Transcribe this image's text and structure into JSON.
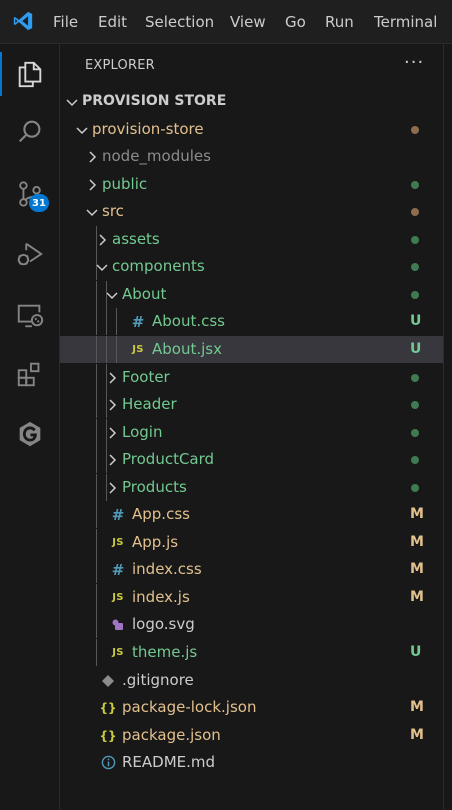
{
  "menu": [
    "File",
    "Edit",
    "Selection",
    "View",
    "Go",
    "Run",
    "Terminal"
  ],
  "activity_bar": {
    "items": [
      {
        "name": "explorer-icon"
      },
      {
        "name": "search-icon"
      },
      {
        "name": "source-control-icon",
        "badge": "31"
      },
      {
        "name": "run-debug-icon"
      },
      {
        "name": "remote-explorer-icon"
      },
      {
        "name": "extensions-icon"
      },
      {
        "name": "gitlens-icon"
      }
    ]
  },
  "explorer": {
    "title": "EXPLORER",
    "more": "···",
    "colors": {
      "untracked": "#73c991",
      "modified": "#e2c08d",
      "ignored": "#8c8c8c",
      "folder_modified": "#8c6e4e",
      "folder_untracked": "#3f7a52",
      "css_icon": "#519aba",
      "js_icon": "#cbcb41",
      "json_icon": "#cbcb41",
      "svg_icon": "#a074c4",
      "info_icon": "#519aba"
    },
    "tree": [
      {
        "label": "PROVISION STORE",
        "depth": 0,
        "kind": "root",
        "chevron": "down",
        "color": "#cccccc"
      },
      {
        "label": "provision-store",
        "depth": 1,
        "kind": "folder",
        "chevron": "down",
        "color": "#e2c08d",
        "dot": "#8c6e4e"
      },
      {
        "label": "node_modules",
        "depth": 2,
        "kind": "folder",
        "chevron": "right",
        "color": "#8c8c8c"
      },
      {
        "label": "public",
        "depth": 2,
        "kind": "folder",
        "chevron": "right",
        "color": "#73c991",
        "dot": "#3f7a52"
      },
      {
        "label": "src",
        "depth": 2,
        "kind": "folder",
        "chevron": "down",
        "color": "#e2c08d",
        "dot": "#8c6e4e"
      },
      {
        "label": "assets",
        "depth": 3,
        "kind": "folder",
        "chevron": "right",
        "color": "#73c991",
        "dot": "#3f7a52"
      },
      {
        "label": "components",
        "depth": 3,
        "kind": "folder",
        "chevron": "down",
        "color": "#73c991",
        "dot": "#3f7a52"
      },
      {
        "label": "About",
        "depth": 4,
        "kind": "folder",
        "chevron": "down",
        "color": "#73c991",
        "dot": "#3f7a52"
      },
      {
        "label": "About.css",
        "depth": 5,
        "kind": "file",
        "icon": "#",
        "icon_color": "#519aba",
        "color": "#73c991",
        "status": "U"
      },
      {
        "label": "About.jsx",
        "depth": 5,
        "kind": "file",
        "icon": "JS",
        "icon_color": "#cbcb41",
        "color": "#73c991",
        "status": "U",
        "selected": true
      },
      {
        "label": "Footer",
        "depth": 4,
        "kind": "folder",
        "chevron": "right",
        "color": "#73c991",
        "dot": "#3f7a52"
      },
      {
        "label": "Header",
        "depth": 4,
        "kind": "folder",
        "chevron": "right",
        "color": "#73c991",
        "dot": "#3f7a52"
      },
      {
        "label": "Login",
        "depth": 4,
        "kind": "folder",
        "chevron": "right",
        "color": "#73c991",
        "dot": "#3f7a52"
      },
      {
        "label": "ProductCard",
        "depth": 4,
        "kind": "folder",
        "chevron": "right",
        "color": "#73c991",
        "dot": "#3f7a52"
      },
      {
        "label": "Products",
        "depth": 4,
        "kind": "folder",
        "chevron": "right",
        "color": "#73c991",
        "dot": "#3f7a52"
      },
      {
        "label": "App.css",
        "depth": 3,
        "kind": "file",
        "icon": "#",
        "icon_color": "#519aba",
        "color": "#e2c08d",
        "status": "M"
      },
      {
        "label": "App.js",
        "depth": 3,
        "kind": "file",
        "icon": "JS",
        "icon_color": "#cbcb41",
        "color": "#e2c08d",
        "status": "M"
      },
      {
        "label": "index.css",
        "depth": 3,
        "kind": "file",
        "icon": "#",
        "icon_color": "#519aba",
        "color": "#e2c08d",
        "status": "M"
      },
      {
        "label": "index.js",
        "depth": 3,
        "kind": "file",
        "icon": "JS",
        "icon_color": "#cbcb41",
        "color": "#e2c08d",
        "status": "M"
      },
      {
        "label": "logo.svg",
        "depth": 3,
        "kind": "file",
        "icon": "svg",
        "icon_color": "#a074c4",
        "color": "#cccccc"
      },
      {
        "label": "theme.js",
        "depth": 3,
        "kind": "file",
        "icon": "JS",
        "icon_color": "#cbcb41",
        "color": "#73c991",
        "status": "U"
      },
      {
        "label": ".gitignore",
        "depth": 2,
        "kind": "file",
        "icon": "git",
        "icon_color": "#8c8c8c",
        "color": "#cccccc"
      },
      {
        "label": "package-lock.json",
        "depth": 2,
        "kind": "file",
        "icon": "{}",
        "icon_color": "#cbcb41",
        "color": "#e2c08d",
        "status": "M"
      },
      {
        "label": "package.json",
        "depth": 2,
        "kind": "file",
        "icon": "{}",
        "icon_color": "#cbcb41",
        "color": "#e2c08d",
        "status": "M"
      },
      {
        "label": "README.md",
        "depth": 2,
        "kind": "file",
        "icon": "info",
        "icon_color": "#519aba",
        "color": "#cccccc"
      }
    ]
  }
}
